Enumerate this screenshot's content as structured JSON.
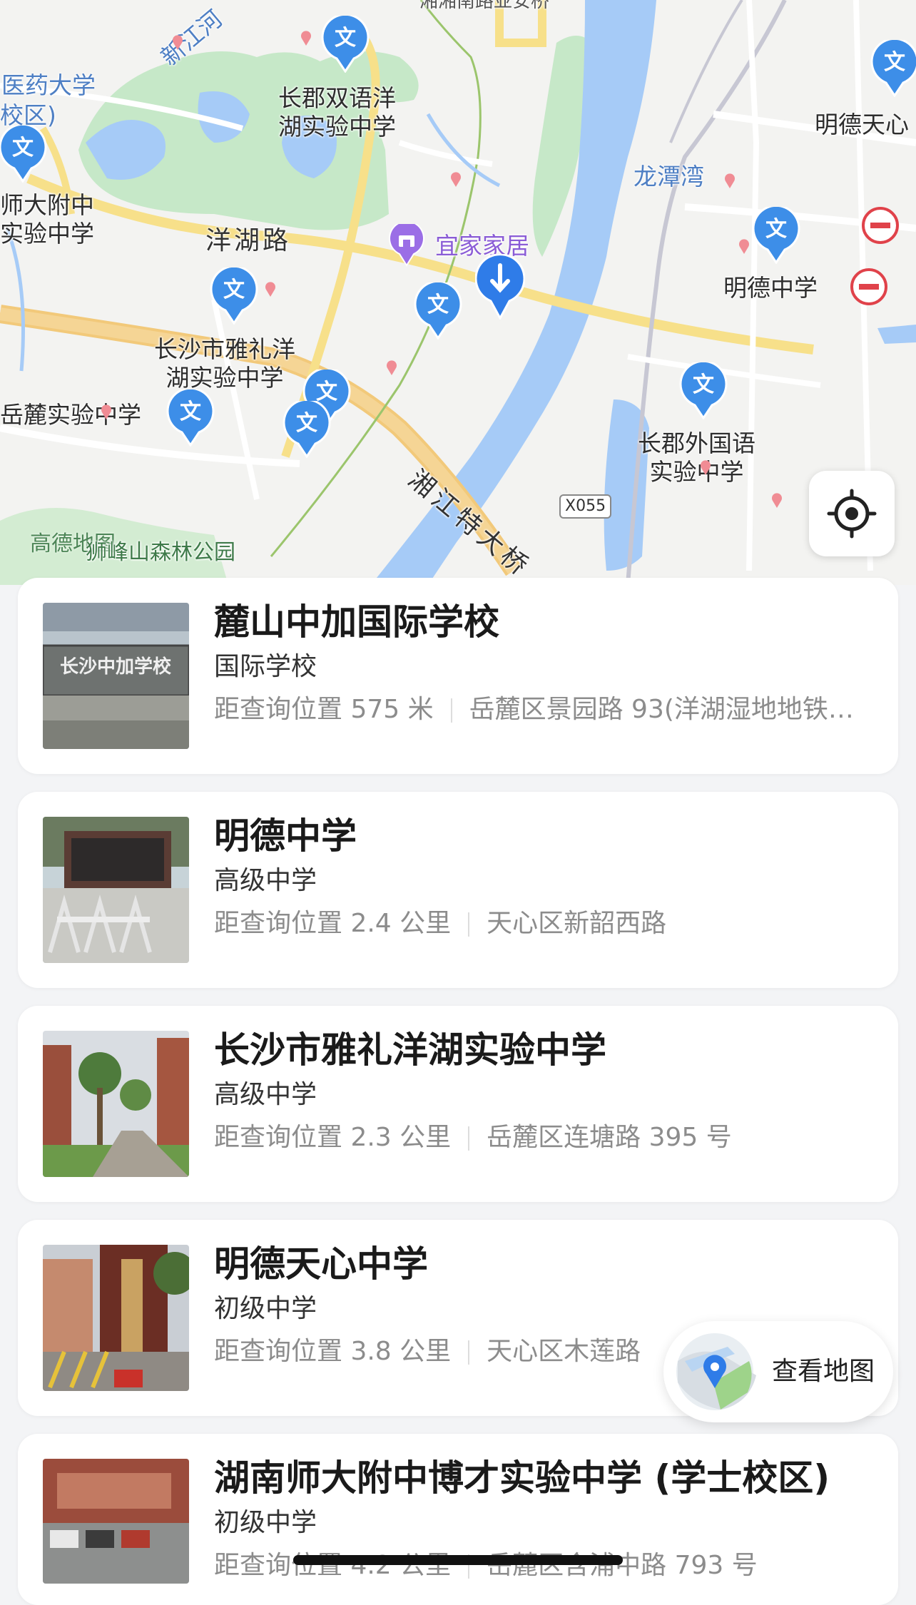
{
  "map": {
    "labels": {
      "hunan_road_top": "湘湘南路亚安桥",
      "yiyao_univ": "医药大学",
      "campus_frag": "校区)",
      "xinjiang_river": "新江河",
      "changjun_bilingual": "长郡双语洋\n湖实验中学",
      "mingde_tianxin_top": "明德天心",
      "shida_fuzhong": "师大附中\n实验中学",
      "longtan_bay": "龙潭湾",
      "yanghu_road": "洋湖路",
      "yijia_home": "宜家家居",
      "mingde_school": "明德中学",
      "yali_yanghu": "长沙市雅礼洋\n湖实验中学",
      "yuelu_exp": "岳麓实验中学",
      "changjun_foreign": "长郡外国语\n实验中学",
      "xiangjiang_bridge": "湘江特大桥",
      "road_shield": "X055",
      "watermark": "高德地图",
      "shifeng_park": "狮峰山森林公园"
    },
    "pin_glyph": "文",
    "colors": {
      "water": "#a6cbf7",
      "green": "#c6e8c8",
      "road_main": "#f2c97a",
      "road_yellow": "#f7e08a",
      "pin_blue": "#3d8ee8",
      "poi_purple": "#9b6ee6",
      "noentry_red": "#e0424a"
    },
    "icons": {
      "locate": "crosshair-target-icon",
      "destination": "blue-down-arrow-marker-icon",
      "school_pin": "school-pin-icon",
      "no_entry": "no-entry-icon",
      "shop": "shop-poi-icon"
    }
  },
  "results": [
    {
      "title": "麓山中加国际学校",
      "category": "国际学校",
      "distance": "距查询位置 575 米",
      "address": "岳麓区景园路 93(洋湖湿地地铁站...",
      "thumb": "school-gate-sign-photo"
    },
    {
      "title": "明德中学",
      "category": "高级中学",
      "distance": "距查询位置 2.4 公里",
      "address": "天心区新韶西路",
      "thumb": "school-entrance-barriers-photo"
    },
    {
      "title": "长沙市雅礼洋湖实验中学",
      "category": "高级中学",
      "distance": "距查询位置 2.3 公里",
      "address": "岳麓区连塘路 395 号",
      "thumb": "campus-road-trees-photo"
    },
    {
      "title": "明德天心中学",
      "category": "初级中学",
      "distance": "距查询位置 3.8 公里",
      "address": "天心区木莲路",
      "thumb": "school-name-wall-photo"
    },
    {
      "title": "湖南师大附中博才实验中学 (学士校区)",
      "category": "初级中学",
      "distance": "距查询位置 4.2 公里",
      "address": "岳麓区含浦中路 793 号",
      "thumb": "school-building-parking-photo"
    }
  ],
  "view_map": {
    "label": "查看地图",
    "icon": "map-pin-icon"
  }
}
